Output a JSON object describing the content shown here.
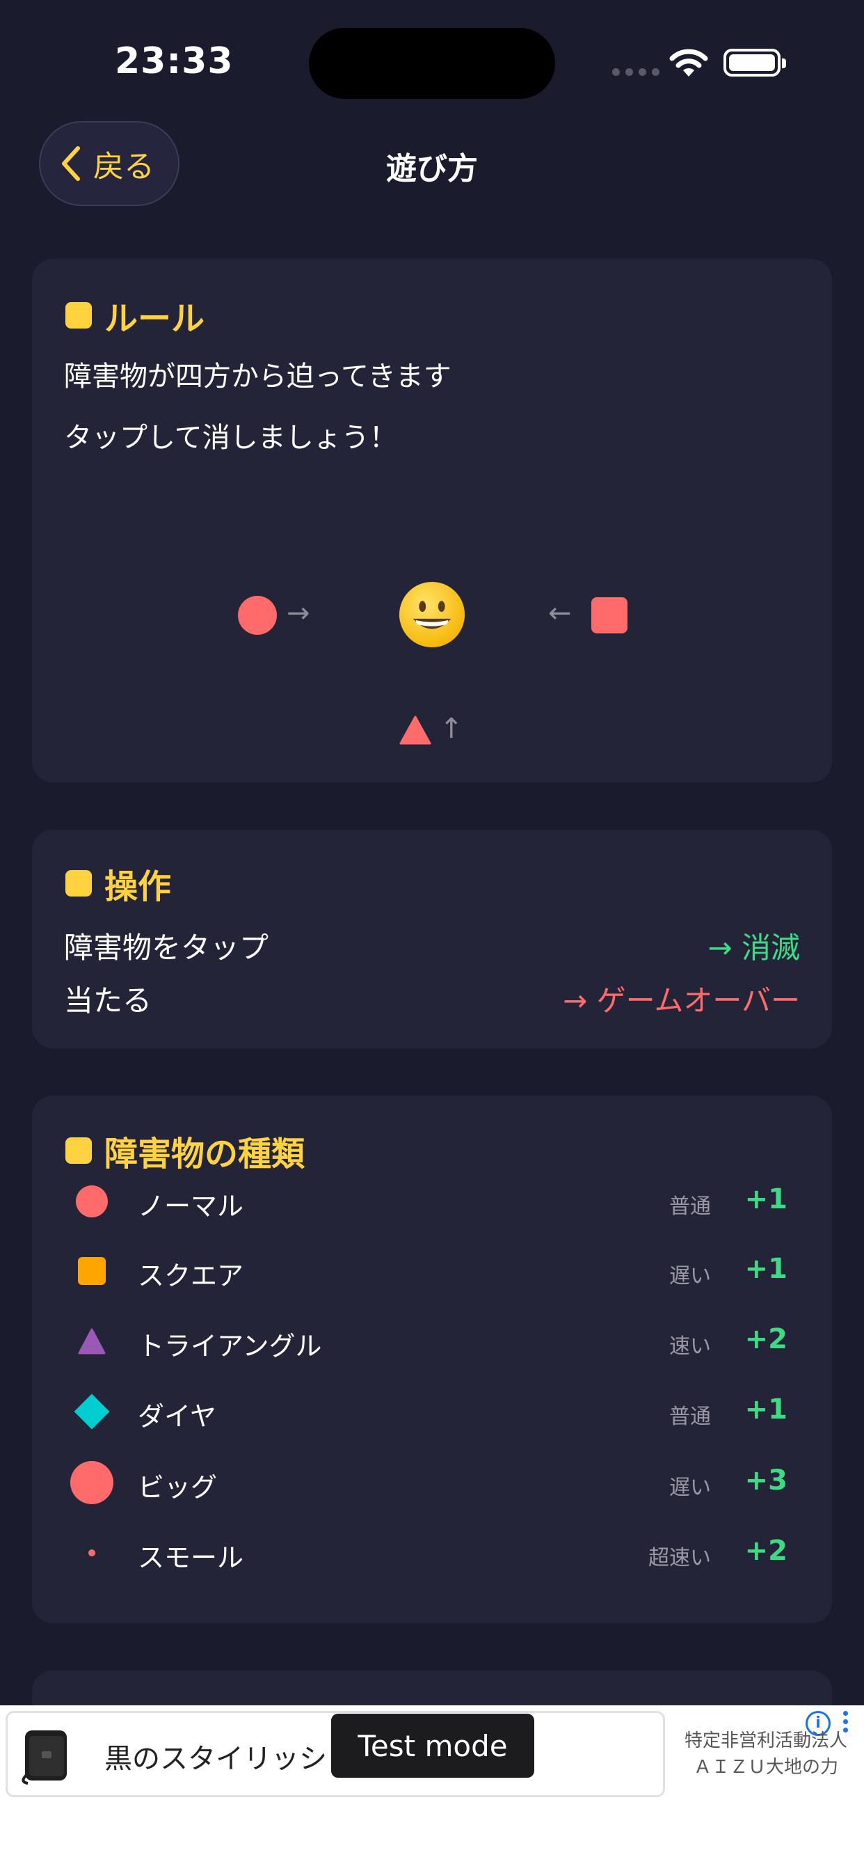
{
  "status_bar": {
    "time": "23:33"
  },
  "nav": {
    "back_label": "戻る",
    "title": "遊び方"
  },
  "rules": {
    "heading": "ルール",
    "line1": "障害物が四方から迫ってきます",
    "line2": "タップして消しましょう！",
    "illustration": {
      "arrow_right": "→",
      "arrow_left": "←",
      "arrow_up": "↑"
    }
  },
  "controls": {
    "heading": "操作",
    "rows": [
      {
        "action": "障害物をタップ",
        "result": "→ 消滅",
        "color": "#3ddc84"
      },
      {
        "action": "当たる",
        "result": "→ ゲームオーバー",
        "color": "#ff6b6b"
      }
    ]
  },
  "obstacles": {
    "heading": "障害物の種類",
    "items": [
      {
        "icon": "red-circle-icon",
        "name": "ノーマル",
        "speed": "普通",
        "points": "+1",
        "color": "#ff6b6b"
      },
      {
        "icon": "orange-square-icon",
        "name": "スクエア",
        "speed": "遅い",
        "points": "+1",
        "color": "#ffa500"
      },
      {
        "icon": "purple-triangle-icon",
        "name": "トライアングル",
        "speed": "速い",
        "points": "+2",
        "color": "#9b59b6"
      },
      {
        "icon": "cyan-diamond-icon",
        "name": "ダイヤ",
        "speed": "普通",
        "points": "+1",
        "color": "#00ced1"
      },
      {
        "icon": "big-red-circle-icon",
        "name": "ビッグ",
        "speed": "遅い",
        "points": "+3",
        "color": "#ff6b6b"
      },
      {
        "icon": "small-red-dot-icon",
        "name": "スモール",
        "speed": "超速い",
        "points": "+2",
        "color": "#ff6b6b"
      }
    ]
  },
  "ad": {
    "text": "黒のスタイリッシュ",
    "test_mode": "Test mode",
    "advertiser_line1": "特定非営利活動法人",
    "advertiser_line2": "ＡＩＺＵ大地の力",
    "info": "i"
  },
  "colors": {
    "accent": "#ffd23f",
    "background": "#1b1b2e",
    "card": "#242438"
  }
}
